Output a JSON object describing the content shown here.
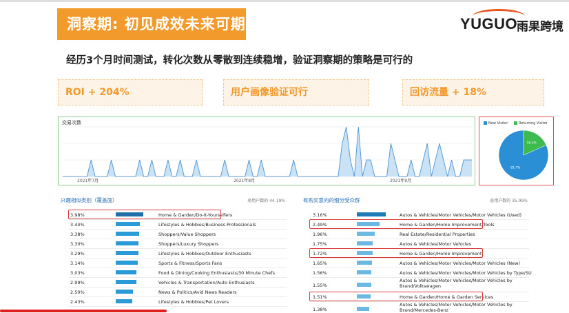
{
  "header": {
    "title": "洞察期: 初见成效未来可期",
    "logo_text": "YUGUO",
    "logo_cn": "雨果跨境",
    "subtitle": "经历3个月时间测试，转化次数从零散到连续稳增，验证洞察期的策略是可行的"
  },
  "kpis": [
    "ROI + 204%",
    "用户画像验证可行",
    "回访流量 + 18%"
  ],
  "colors": {
    "accent": "#f39a2c",
    "bar": "#2b9bd8",
    "highlight": "#d93b3b",
    "area": "#c9e2f5",
    "line": "#5b9bd5"
  },
  "chart_data": [
    {
      "type": "area",
      "title": "交易次数",
      "x_ticks": [
        "2021年7月",
        "2021年8月",
        "2021年9月"
      ],
      "values": [
        0,
        0,
        0,
        0,
        0,
        0,
        0,
        1,
        0,
        0,
        0,
        0,
        1,
        0,
        0,
        0,
        0,
        0,
        0,
        1,
        0,
        0,
        1,
        0,
        0,
        0,
        1,
        0,
        0,
        1,
        0,
        0,
        0,
        1,
        0,
        0,
        0,
        0,
        0,
        0,
        1,
        0,
        0,
        0,
        0,
        0,
        1,
        0,
        0,
        1,
        0,
        0,
        0,
        0,
        0,
        0,
        0,
        1,
        0,
        0,
        0,
        0,
        0,
        0,
        0,
        0,
        0,
        0,
        0,
        2,
        3,
        1,
        0,
        3,
        0,
        1,
        1,
        0,
        0,
        0,
        0,
        2,
        1,
        0,
        0,
        0,
        1,
        0,
        0,
        1,
        2,
        0,
        1,
        2,
        1,
        0,
        1,
        0,
        0,
        1,
        1,
        1
      ],
      "ylim": [
        0,
        3
      ]
    },
    {
      "type": "pie",
      "legend": [
        "New Visitor",
        "Returning Visitor"
      ],
      "values": [
        81.7,
        18.3
      ],
      "labels": [
        "81.7%",
        "18.3%"
      ],
      "colors": [
        "#2b8fd6",
        "#3dbb4f"
      ]
    }
  ],
  "left_panel": {
    "title": "兴趣相似类别（覆盖面）",
    "total": "总用户数的 44.19%",
    "rows": [
      {
        "pct": "3.98%",
        "value": 3.98,
        "label": "Home & Garden/Do-It-Yourselfers"
      },
      {
        "pct": "3.44%",
        "value": 3.44,
        "label": "Lifestyles & Hobbies/Business Professionals"
      },
      {
        "pct": "3.38%",
        "value": 3.38,
        "label": "Shoppers/Value Shoppers"
      },
      {
        "pct": "3.30%",
        "value": 3.3,
        "label": "Shoppers/Luxury Shoppers"
      },
      {
        "pct": "3.29%",
        "value": 3.29,
        "label": "Lifestyles & Hobbies/Outdoor Enthusiasts"
      },
      {
        "pct": "3.14%",
        "value": 3.14,
        "label": "Sports & Fitness/Sports Fans"
      },
      {
        "pct": "3.03%",
        "value": 3.03,
        "label": "Food & Dining/Cooking Enthusiasts/30 Minute Chefs"
      },
      {
        "pct": "2.99%",
        "value": 2.99,
        "label": "Vehicles & Transportation/Auto Enthusiasts"
      },
      {
        "pct": "2.50%",
        "value": 2.5,
        "label": "News & Politics/Avid News Readers"
      },
      {
        "pct": "2.43%",
        "value": 2.43,
        "label": "Lifestyles & Hobbies/Pet Lovers"
      }
    ]
  },
  "right_panel": {
    "title": "有购买意向的细分受众群",
    "total": "总用户数的 35.99%",
    "rows": [
      {
        "pct": "3.16%",
        "value": 3.16,
        "label": "Autos & Vehicles/Motor Vehicles/Motor Vehicles (Used)"
      },
      {
        "pct": "2.49%",
        "value": 2.49,
        "label": "Home & Garden/Home Improvement/Tools"
      },
      {
        "pct": "1.96%",
        "value": 1.96,
        "label": "Real Estate/Residential Properties"
      },
      {
        "pct": "1.75%",
        "value": 1.75,
        "label": "Autos & Vehicles/Motor Vehicles"
      },
      {
        "pct": "1.72%",
        "value": 1.72,
        "label": "Home & Garden/Home Improvement"
      },
      {
        "pct": "1.65%",
        "value": 1.65,
        "label": "Autos & Vehicles/Motor Vehicles/Motor Vehicles (New)"
      },
      {
        "pct": "1.56%",
        "value": 1.56,
        "label": "Autos & Vehicles/Motor Vehicles/Motor Vehicles by Type/SUVs"
      },
      {
        "pct": "1.55%",
        "value": 1.55,
        "label": "Autos & Vehicles/Motor Vehicles/Motor Vehicles by",
        "label2": "Brand/Volkswagen"
      },
      {
        "pct": "1.51%",
        "value": 1.51,
        "label": "Home & Garden/Home & Garden Services"
      },
      {
        "pct": "1.38%",
        "value": 1.38,
        "label": "Autos & Vehicles/Motor Vehicles/Motor Vehicles by",
        "label2": "Brand/Mercedes-Benz"
      }
    ]
  }
}
